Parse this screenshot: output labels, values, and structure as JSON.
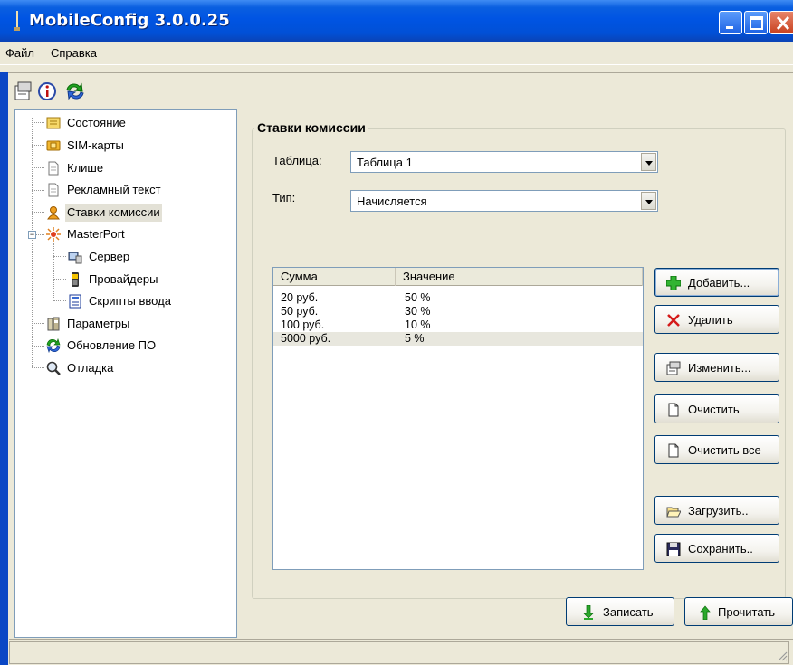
{
  "window": {
    "title": "MobileConfig 3.0.0.25"
  },
  "menu": {
    "items": [
      "Файл",
      "Справка"
    ]
  },
  "toolbar": {
    "icons": [
      "properties-icon",
      "info-icon",
      "update-icon"
    ]
  },
  "tree": {
    "items": [
      {
        "label": "Состояние",
        "icon": "status-icon"
      },
      {
        "label": "SIM-карты",
        "icon": "sim-card-icon"
      },
      {
        "label": "Клише",
        "icon": "document-icon"
      },
      {
        "label": "Рекламный текст",
        "icon": "document-icon"
      },
      {
        "label": "Ставки комиссии",
        "icon": "users-icon",
        "selected": true
      },
      {
        "label": "MasterPort",
        "icon": "network-icon",
        "expanded": true
      },
      {
        "label": "Сервер",
        "icon": "server-icon"
      },
      {
        "label": "Провайдеры",
        "icon": "phone-icon"
      },
      {
        "label": "Скрипты ввода",
        "icon": "script-icon"
      },
      {
        "label": "Параметры",
        "icon": "settings-icon"
      },
      {
        "label": "Обновление ПО",
        "icon": "update-icon"
      },
      {
        "label": "Отладка",
        "icon": "magnifier-icon"
      }
    ]
  },
  "panel": {
    "title": "Ставки комиссии",
    "table_label": "Таблица:",
    "table_value": "Таблица 1",
    "type_label": "Тип:",
    "type_value": "Начисляется"
  },
  "list": {
    "columns": [
      "Сумма",
      "Значение"
    ],
    "rows": [
      {
        "sum": "20 руб.",
        "value": "50 %"
      },
      {
        "sum": "50 руб.",
        "value": "30 %"
      },
      {
        "sum": "100 руб.",
        "value": "10 %"
      },
      {
        "sum": "5000 руб.",
        "value": "5 %",
        "selected": true
      }
    ]
  },
  "buttons": {
    "add": "Добавить...",
    "delete": "Удалить",
    "edit": "Изменить...",
    "clear": "Очистить",
    "clear_all": "Очистить все",
    "load": "Загрузить..",
    "save": "Сохранить..",
    "write": "Записать",
    "read": "Прочитать"
  },
  "colors": {
    "titlebar": "#0054e3",
    "window_bg": "#ece9d8",
    "border": "#7f9db9"
  }
}
